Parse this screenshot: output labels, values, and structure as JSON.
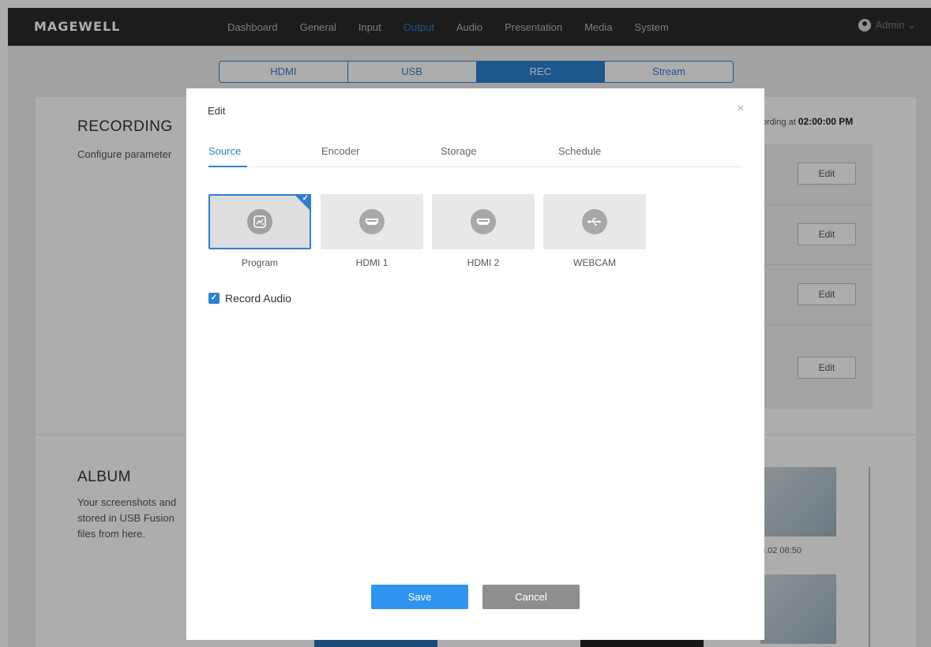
{
  "brand": "MAGEWELL",
  "nav": {
    "items": [
      "Dashboard",
      "General",
      "Input",
      "Output",
      "Audio",
      "Presentation",
      "Media",
      "System"
    ],
    "active": "Output",
    "user": "Admin ⌄"
  },
  "subtabs": {
    "items": [
      "HDMI",
      "USB",
      "REC",
      "Stream"
    ],
    "active": "REC"
  },
  "recording": {
    "title": "RECORDING",
    "desc": "Configure parameter",
    "status_prefix": "ording at",
    "status_time": "02:00:00 PM",
    "edit_label": "Edit"
  },
  "album": {
    "title": "ALBUM",
    "desc": "Your screenshots and stored in USB Fusion files from here.",
    "thumb_time": "8.02 08:50"
  },
  "modal": {
    "title": "Edit",
    "close": "×",
    "tabs": [
      "Source",
      "Encoder",
      "Storage",
      "Schedule"
    ],
    "active_tab": "Source",
    "sources": [
      {
        "label": "Program",
        "icon": "program-icon",
        "selected": true
      },
      {
        "label": "HDMI 1",
        "icon": "hdmi-icon",
        "selected": false
      },
      {
        "label": "HDMI 2",
        "icon": "hdmi-icon",
        "selected": false
      },
      {
        "label": "WEBCAM",
        "icon": "usb-icon",
        "selected": false
      }
    ],
    "record_audio_label": "Record Audio",
    "record_audio_checked": true,
    "save_label": "Save",
    "cancel_label": "Cancel"
  },
  "colors": {
    "accent": "#2d7fd2",
    "save": "#2d95f0",
    "cancel": "#8e8e8e",
    "topbar": "#2a2a2c"
  }
}
